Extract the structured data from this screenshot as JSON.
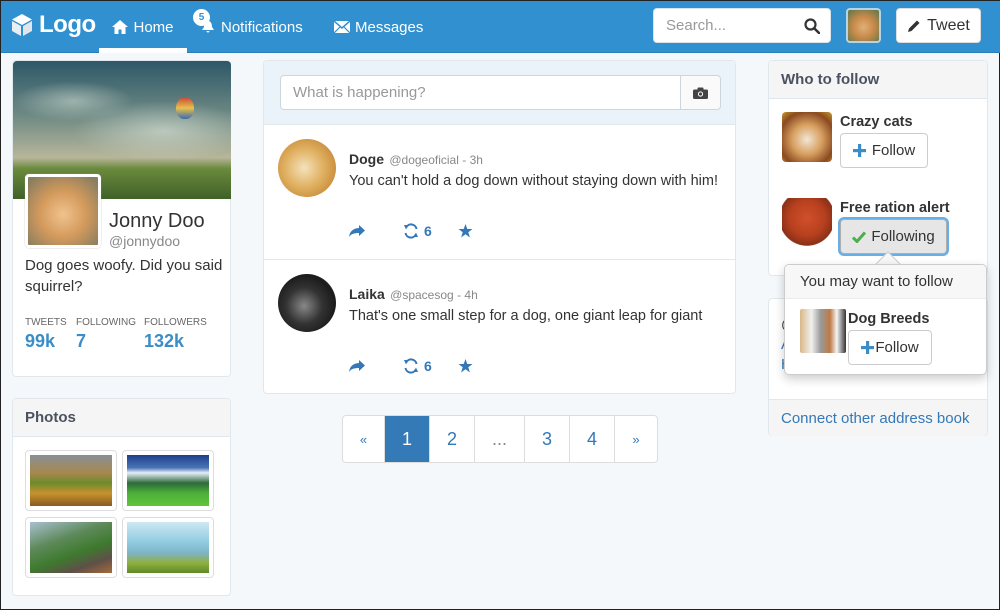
{
  "navbar": {
    "logo": "Logo",
    "items": [
      {
        "label": "Home",
        "icon": "home-icon",
        "active": true
      },
      {
        "label": "Notifications",
        "icon": "bell-icon",
        "badge": "5"
      },
      {
        "label": "Messages",
        "icon": "envelope-icon"
      }
    ],
    "search_placeholder": "Search...",
    "tweet_button": "Tweet",
    "brand_color": "#3190d0"
  },
  "profile": {
    "name": "Jonny Doo",
    "handle": "@jonnydoo",
    "bio": "Dog goes woofy. Did you said squirrel?",
    "stats": [
      {
        "label": "TWEETS",
        "value": "99k"
      },
      {
        "label": "FOLLOWING",
        "value": "7"
      },
      {
        "label": "FOLLOWERS",
        "value": "132k"
      }
    ]
  },
  "photos": {
    "title": "Photos",
    "items": [
      "mountain-sunset",
      "alpine-meadow",
      "dog-on-cliff",
      "dog-by-lake"
    ]
  },
  "compose": {
    "placeholder": "What is happening?"
  },
  "tweets": [
    {
      "name": "Doge",
      "handle": "@dogeoficial",
      "time": "- 3h",
      "text": "You can't hold a dog down without staying down with him!",
      "retweets": "6"
    },
    {
      "name": "Laika",
      "handle": "@spacesog",
      "time": "- 4h",
      "text": "That's one small step for a dog, one giant leap for giant",
      "retweets": "6"
    }
  ],
  "pagination": {
    "prev": "«",
    "pages": [
      "1",
      "2",
      "...",
      "3",
      "4"
    ],
    "next": "»",
    "active": "1"
  },
  "who_to_follow": {
    "title": "Who to follow",
    "items": [
      {
        "name": "Crazy cats",
        "button": "Follow",
        "state": "follow"
      },
      {
        "name": "Free ration alert",
        "button": "Following",
        "state": "following"
      }
    ]
  },
  "popover": {
    "title": "You may want to follow",
    "item": {
      "name": "Dog Breeds",
      "button": "Follow"
    }
  },
  "address_book": {
    "partial_lines": [
      "@",
      "A",
      "H"
    ],
    "footer_link": "Connect other address book"
  }
}
